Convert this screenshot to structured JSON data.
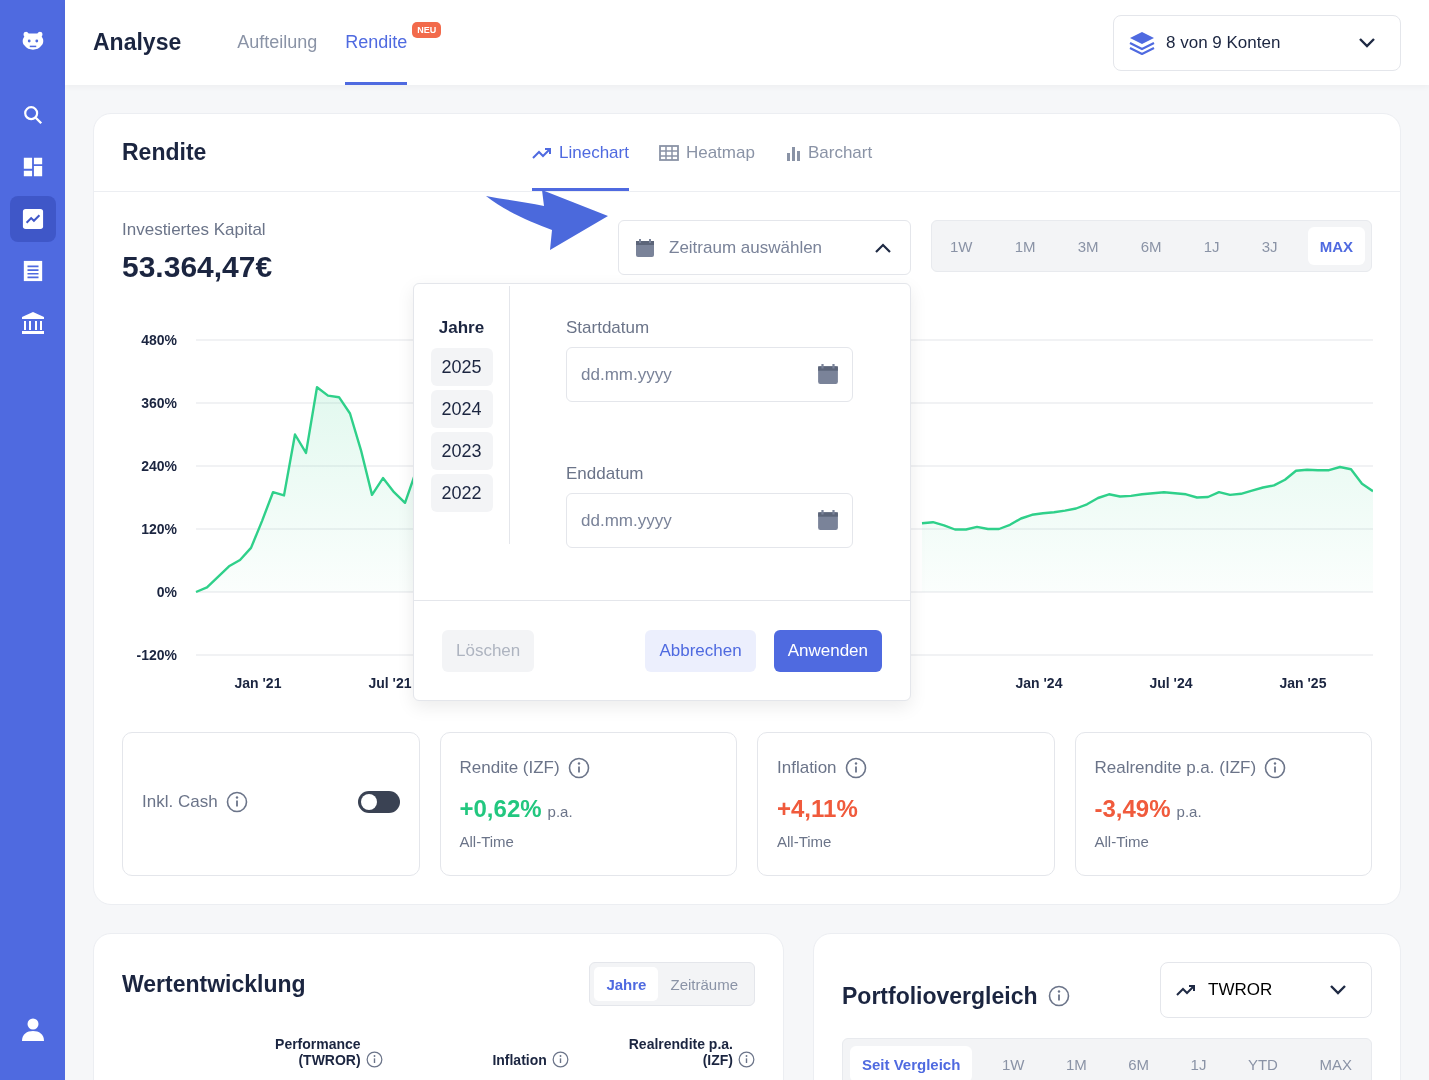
{
  "sidebar": {
    "items": [
      {
        "selected": false
      },
      {
        "selected": false
      },
      {
        "selected": true
      },
      {
        "selected": false
      },
      {
        "selected": false
      }
    ]
  },
  "header": {
    "title": "Analyse",
    "tabs": [
      {
        "label": "Aufteilung",
        "selected": false
      },
      {
        "label": "Rendite",
        "selected": true,
        "badge": "NEU"
      }
    ],
    "account_selector": "8 von 9 Konten"
  },
  "rendite": {
    "title": "Rendite",
    "view_tabs": [
      {
        "label": "Linechart",
        "selected": true
      },
      {
        "label": "Heatmap",
        "selected": false
      },
      {
        "label": "Barchart",
        "selected": false
      }
    ],
    "capital_label": "Investiertes Kapital",
    "capital_value": "53.364,47€",
    "date_range": {
      "placeholder": "Zeitraum auswählen",
      "expanded": true
    },
    "ranges": [
      {
        "label": "1W",
        "selected": false
      },
      {
        "label": "1M",
        "selected": false
      },
      {
        "label": "3M",
        "selected": false
      },
      {
        "label": "6M",
        "selected": false
      },
      {
        "label": "1J",
        "selected": false
      },
      {
        "label": "3J",
        "selected": false
      },
      {
        "label": "MAX",
        "selected": true
      }
    ],
    "popup": {
      "years_title": "Jahre",
      "years": [
        "2025",
        "2024",
        "2023",
        "2022"
      ],
      "start_label": "Startdatum",
      "start_placeholder": "dd.mm.yyyy",
      "end_label": "Enddatum",
      "end_placeholder": "dd.mm.yyyy",
      "buttons": [
        {
          "label": "Löschen",
          "kind": "clear",
          "disabled": true
        },
        {
          "label": "Abbrechen",
          "kind": "cancel",
          "disabled": false
        },
        {
          "label": "Anwenden",
          "kind": "apply",
          "disabled": false
        }
      ]
    },
    "chart_data": {
      "type": "area",
      "grid": true,
      "categories": [
        null,
        null,
        null,
        null,
        null,
        null,
        "Jan '21",
        null,
        null,
        null,
        null,
        null,
        null,
        null,
        null,
        null,
        null,
        null,
        "Jul '21",
        null,
        null,
        null,
        null,
        null,
        null,
        null,
        null,
        null,
        null,
        null,
        null,
        null,
        null,
        null,
        null,
        null,
        null,
        null,
        null,
        null,
        null,
        null,
        null,
        null,
        null,
        null,
        null,
        null,
        null,
        null,
        null,
        null,
        null,
        null,
        null,
        null,
        null,
        null,
        null,
        null,
        null,
        null,
        null,
        null,
        null,
        null,
        null,
        null,
        null,
        null,
        null,
        null,
        null,
        null,
        null,
        null,
        null,
        "Jan '24",
        null,
        null,
        null,
        null,
        null,
        null,
        null,
        null,
        null,
        null,
        null,
        "Jul '24",
        null,
        null,
        null,
        null,
        null,
        null,
        null,
        null,
        null,
        null,
        null,
        "Jan '25",
        null,
        null,
        null,
        null,
        null,
        null
      ],
      "series": [
        {
          "color": "#2fd08a",
          "values": [
            0,
            9,
            29,
            49,
            61,
            84,
            135,
            190,
            184,
            300,
            265,
            390,
            374,
            371,
            340,
            270,
            185,
            217,
            190,
            170,
            230,
            null,
            null,
            null,
            null,
            null,
            null,
            null,
            null,
            null,
            null,
            null,
            null,
            null,
            null,
            null,
            null,
            null,
            null,
            null,
            null,
            null,
            null,
            null,
            null,
            null,
            null,
            null,
            null,
            null,
            null,
            null,
            null,
            null,
            null,
            null,
            null,
            null,
            null,
            null,
            null,
            null,
            null,
            null,
            null,
            null,
            131,
            133,
            127,
            119,
            119,
            124,
            120,
            120,
            128,
            140,
            147,
            150,
            152,
            155,
            159,
            167,
            179,
            186,
            182,
            183,
            186,
            188,
            190,
            188,
            186,
            180,
            181,
            190,
            185,
            187,
            193,
            199,
            203,
            214,
            231,
            233,
            232,
            232,
            238,
            234,
            206,
            192
          ]
        }
      ],
      "ylim": [
        -120,
        480
      ],
      "yticks": [
        {
          "value": 480,
          "label": "480%"
        },
        {
          "value": 360,
          "label": "360%"
        },
        {
          "value": 240,
          "label": "240%"
        },
        {
          "value": 120,
          "label": "120%"
        },
        {
          "value": 0,
          "label": "0%"
        },
        {
          "value": -120,
          "label": "-120%"
        }
      ]
    },
    "cards": [
      {
        "kind": "toggle",
        "title": "Inkl. Cash",
        "on": false
      },
      {
        "kind": "metric",
        "title": "Rendite (IZF)",
        "value": "+0,62%",
        "color": "#22c77f",
        "unit": "p.a.",
        "note": "All-Time"
      },
      {
        "kind": "metric",
        "title": "Inflation",
        "value": "+4,11%",
        "color": "#f05a3c",
        "note": "All-Time"
      },
      {
        "kind": "metric",
        "title": "Realrendite p.a. (IZF)",
        "value": "-3,49%",
        "color": "#f05a3c",
        "unit": "p.a.",
        "note": "All-Time"
      }
    ]
  },
  "wertentwicklung": {
    "title": "Wertentwicklung",
    "segments": [
      {
        "label": "Jahre",
        "selected": true
      },
      {
        "label": "Zeiträume",
        "selected": false
      }
    ],
    "columns": [
      "Performance (TWROR)",
      "Inflation",
      "Realrendite p.a.(IZF)"
    ]
  },
  "portfoliovergleich": {
    "title": "Portfoliovergleich",
    "metric": "TWROR",
    "ranges": [
      {
        "label": "Seit Vergleich",
        "selected": true
      },
      {
        "label": "1W",
        "selected": false
      },
      {
        "label": "1M",
        "selected": false
      },
      {
        "label": "6M",
        "selected": false
      },
      {
        "label": "1J",
        "selected": false
      },
      {
        "label": "YTD",
        "selected": false
      },
      {
        "label": "MAX",
        "selected": false
      }
    ]
  }
}
